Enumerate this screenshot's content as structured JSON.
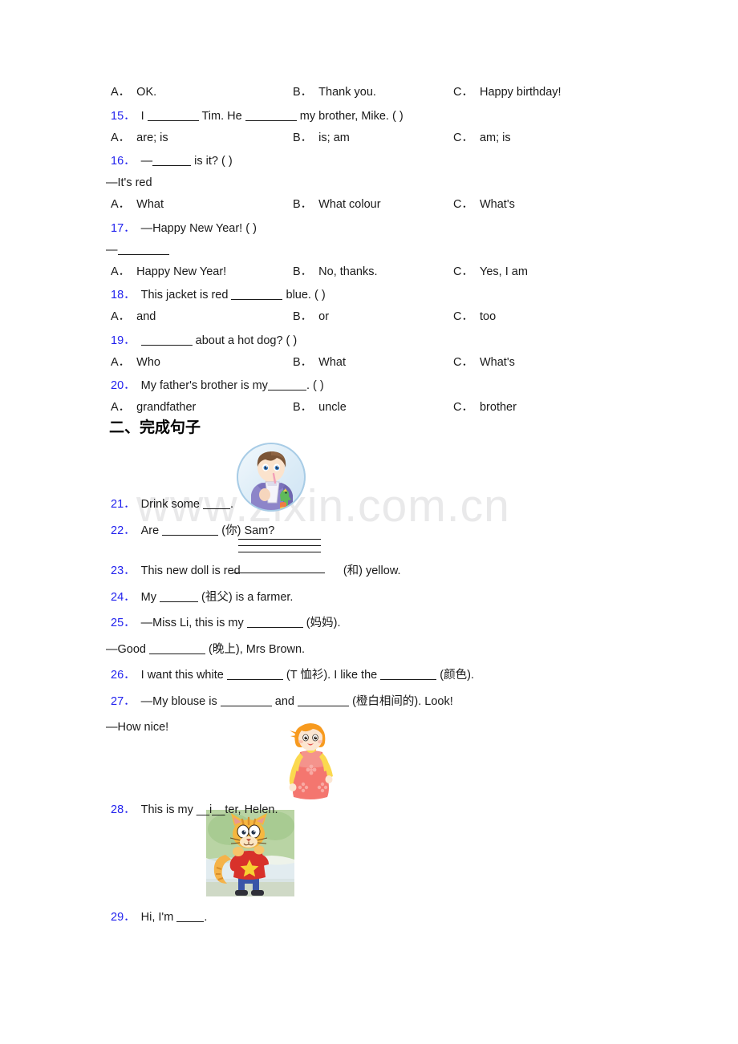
{
  "watermark": "www.zixin.com.cn",
  "colors": {
    "question_number": "#2222ee",
    "text": "#1a1a1a",
    "watermark": "#e9e9ea"
  },
  "part_one": {
    "options_top": [
      {
        "label": "A．",
        "text": "OK."
      },
      {
        "label": "B．",
        "text": "Thank you."
      },
      {
        "label": "C．",
        "text": "Happy birthday!"
      }
    ],
    "questions": [
      {
        "number": "15．",
        "stem_before": "I",
        "stem_mid": "Tim. He",
        "stem_after": "my brother, Mike. (  )",
        "options": [
          {
            "label": "A．",
            "text": "are; is"
          },
          {
            "label": "B．",
            "text": "is; am"
          },
          {
            "label": "C．",
            "text": "am; is"
          }
        ]
      },
      {
        "number": "16．",
        "stem_before": "—",
        "stem_after": "is it? (   )",
        "extra_line": "—It's red",
        "options": [
          {
            "label": "A．",
            "text": "What"
          },
          {
            "label": "B．",
            "text": "What colour"
          },
          {
            "label": "C．",
            "text": "What's"
          }
        ]
      },
      {
        "number": "17．",
        "stem_full": "—Happy New Year! (   )",
        "answer_dash": "—",
        "options": [
          {
            "label": "A．",
            "text": "Happy New Year!"
          },
          {
            "label": "B．",
            "text": "No, thanks."
          },
          {
            "label": "C．",
            "text": "Yes, I am"
          }
        ]
      },
      {
        "number": "18．",
        "stem_before": "This jacket is red",
        "stem_after": "blue. (  )",
        "options": [
          {
            "label": "A．",
            "text": "and"
          },
          {
            "label": "B．",
            "text": "or"
          },
          {
            "label": "C．",
            "text": "too"
          }
        ]
      },
      {
        "number": "19．",
        "stem_after": "about a hot dog? (  )",
        "options": [
          {
            "label": "A．",
            "text": "Who"
          },
          {
            "label": "B．",
            "text": "What"
          },
          {
            "label": "C．",
            "text": "What's"
          }
        ]
      },
      {
        "number": "20．",
        "stem_before": "My father's brother is my",
        "stem_after": ". (  )",
        "options": [
          {
            "label": "A．",
            "text": "grandfather"
          },
          {
            "label": "B．",
            "text": "uncle"
          },
          {
            "label": "C．",
            "text": "brother"
          }
        ]
      }
    ]
  },
  "part_two": {
    "heading": "二、完成句子",
    "items": [
      {
        "number": "21．",
        "before": "Drink some",
        "after": "."
      },
      {
        "number": "22．",
        "before": "Are",
        "after": "(你) Sam?"
      },
      {
        "number": "23．",
        "before": "This new doll is red",
        "after": "(和) yellow."
      },
      {
        "number": "24．",
        "before": "My",
        "after": "(祖父) is a farmer."
      },
      {
        "number": "25．",
        "before": "—Miss Li, this is my",
        "after": "(妈妈).",
        "sub_before": "—Good",
        "sub_after": "(晚上), Mrs Brown."
      },
      {
        "number": "26．",
        "before": "I want this white",
        "mid": "(T 恤衫). I like the",
        "after": "(颜色)."
      },
      {
        "number": "27．",
        "before": "—My blouse is",
        "mid": "and",
        "after": "(橙白相间的). Look!",
        "sub_text": "—How nice!"
      },
      {
        "number": "28．",
        "text": "This is my __i__ter, Helen."
      },
      {
        "number": "29．",
        "before": "Hi, I'm",
        "after": "."
      }
    ]
  },
  "images": {
    "boy_drinking": "boy-drinking-illustration",
    "girl_pink_dress": "girl-illustration",
    "cat_red_shirt": "cat-illustration"
  }
}
